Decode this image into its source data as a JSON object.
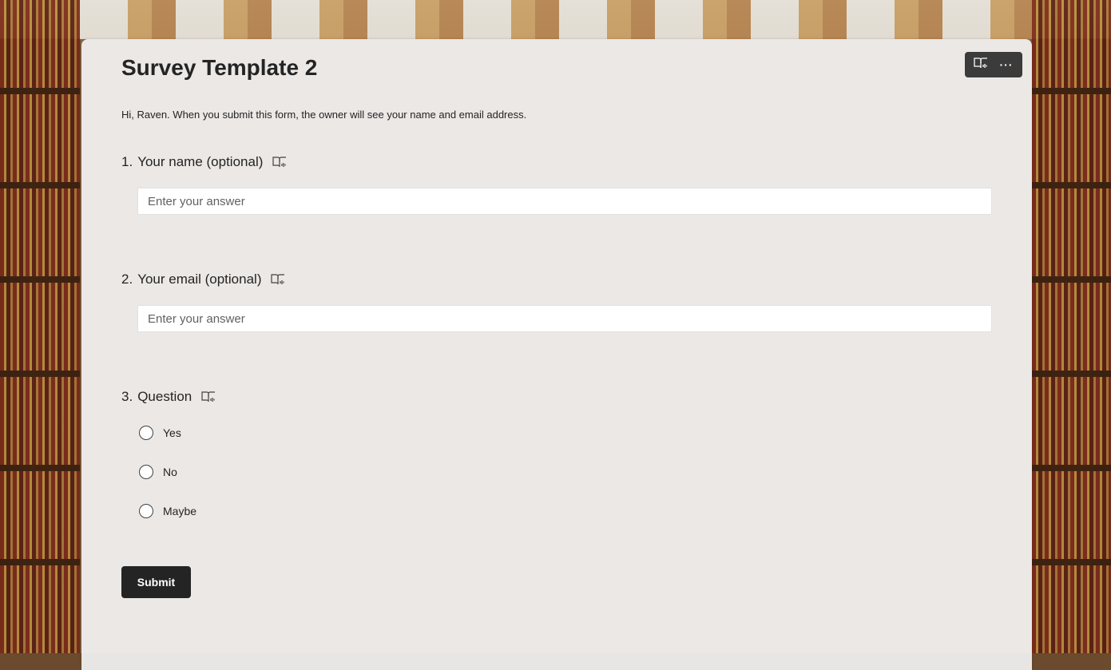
{
  "form": {
    "title": "Survey Template 2",
    "info_text": "Hi, Raven. When you submit this form, the owner will see your name and email address.",
    "submit_label": "Submit"
  },
  "toolbar": {
    "items": [
      {
        "icon": "immersive-reader-icon"
      },
      {
        "icon": "more-options-icon",
        "label": "···"
      }
    ]
  },
  "questions": [
    {
      "number": "1.",
      "title": "Your name (optional)",
      "placeholder": "Enter your answer",
      "value": ""
    },
    {
      "number": "2.",
      "title": "Your email (optional)",
      "placeholder": "Enter your answer",
      "value": ""
    },
    {
      "number": "3.",
      "title": "Question",
      "options": [
        "Yes",
        "No",
        "Maybe"
      ]
    }
  ]
}
